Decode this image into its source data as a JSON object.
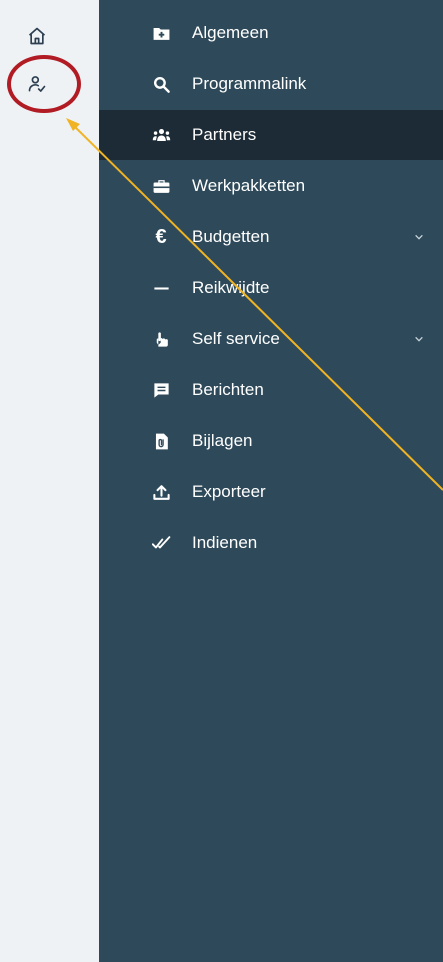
{
  "rail": {
    "icons": [
      "home-icon",
      "user-check-icon"
    ]
  },
  "nav": {
    "items": [
      {
        "label": "Algemeen",
        "icon": "folder-plus-icon"
      },
      {
        "label": "Programmalink",
        "icon": "search-icon"
      },
      {
        "label": "Partners",
        "icon": "users-icon",
        "active": true
      },
      {
        "label": "Werkpakketten",
        "icon": "briefcase-icon"
      },
      {
        "label": "Budgetten",
        "icon": "euro-icon",
        "has_children": true
      },
      {
        "label": "Reikwijdte",
        "icon": "minus-icon"
      },
      {
        "label": "Self service",
        "icon": "hand-pointer-icon",
        "has_children": true
      },
      {
        "label": "Berichten",
        "icon": "message-icon"
      },
      {
        "label": "Bijlagen",
        "icon": "attachment-file-icon"
      },
      {
        "label": "Exporteer",
        "icon": "upload-icon"
      },
      {
        "label": "Indienen",
        "icon": "double-check-icon"
      }
    ],
    "euro_symbol": "€"
  },
  "colors": {
    "rail_bg": "#eef2f5",
    "nav_bg": "#2e4a5a",
    "active_bg": "#1d2b36",
    "annotation_circle": "#b11c24",
    "annotation_arrow": "#f0b323"
  }
}
